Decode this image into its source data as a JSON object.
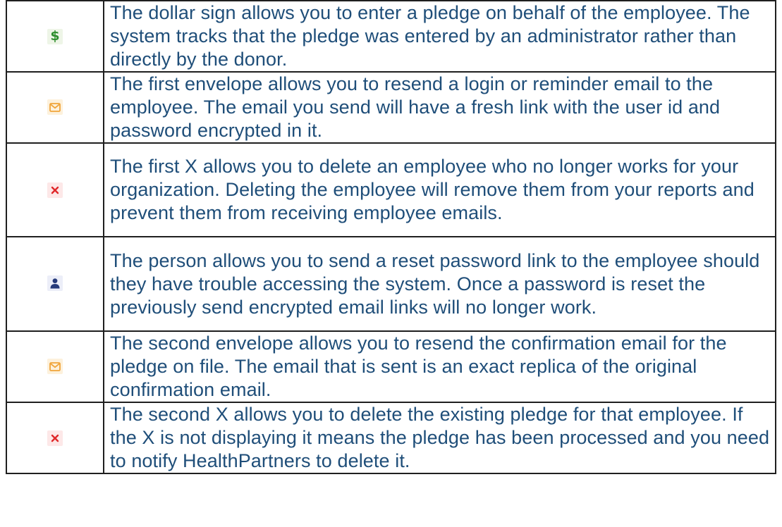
{
  "icons": {
    "dollar": "$",
    "colors": {
      "dollar": "#2f8f2f",
      "envelope": "#f0a53a",
      "x": "#e0282a",
      "person": "#263a7a",
      "text": "#1f4e79"
    }
  },
  "rows": [
    {
      "icon": "dollar-icon",
      "text": "The dollar sign allows you to enter a pledge on behalf of the employee. The system tracks that the pledge was entered by an administrator rather than directly by the donor."
    },
    {
      "icon": "envelope-icon",
      "text": "The first envelope allows you to resend a login or reminder email to the employee. The email you send will have a fresh link with the user id and password encrypted in it."
    },
    {
      "icon": "x-icon",
      "text": "The first X allows you to delete an employee who no longer works for your organization. Deleting the employee will remove them from your reports and prevent them from receiving employee emails."
    },
    {
      "icon": "person-icon",
      "text": "The person allows you to send a reset password link to the employee should they have trouble accessing the system. Once a password is reset the previously send encrypted email links will no longer work."
    },
    {
      "icon": "envelope-icon",
      "text": "The second envelope allows you to resend the confirmation email for the pledge on file. The email that is sent is an exact replica of the original confirmation email."
    },
    {
      "icon": "x-icon",
      "text": "The second X allows you to delete the existing pledge for that employee. If the X is not displaying it means the pledge has been processed and you need to notify HealthPartners to delete it."
    }
  ]
}
